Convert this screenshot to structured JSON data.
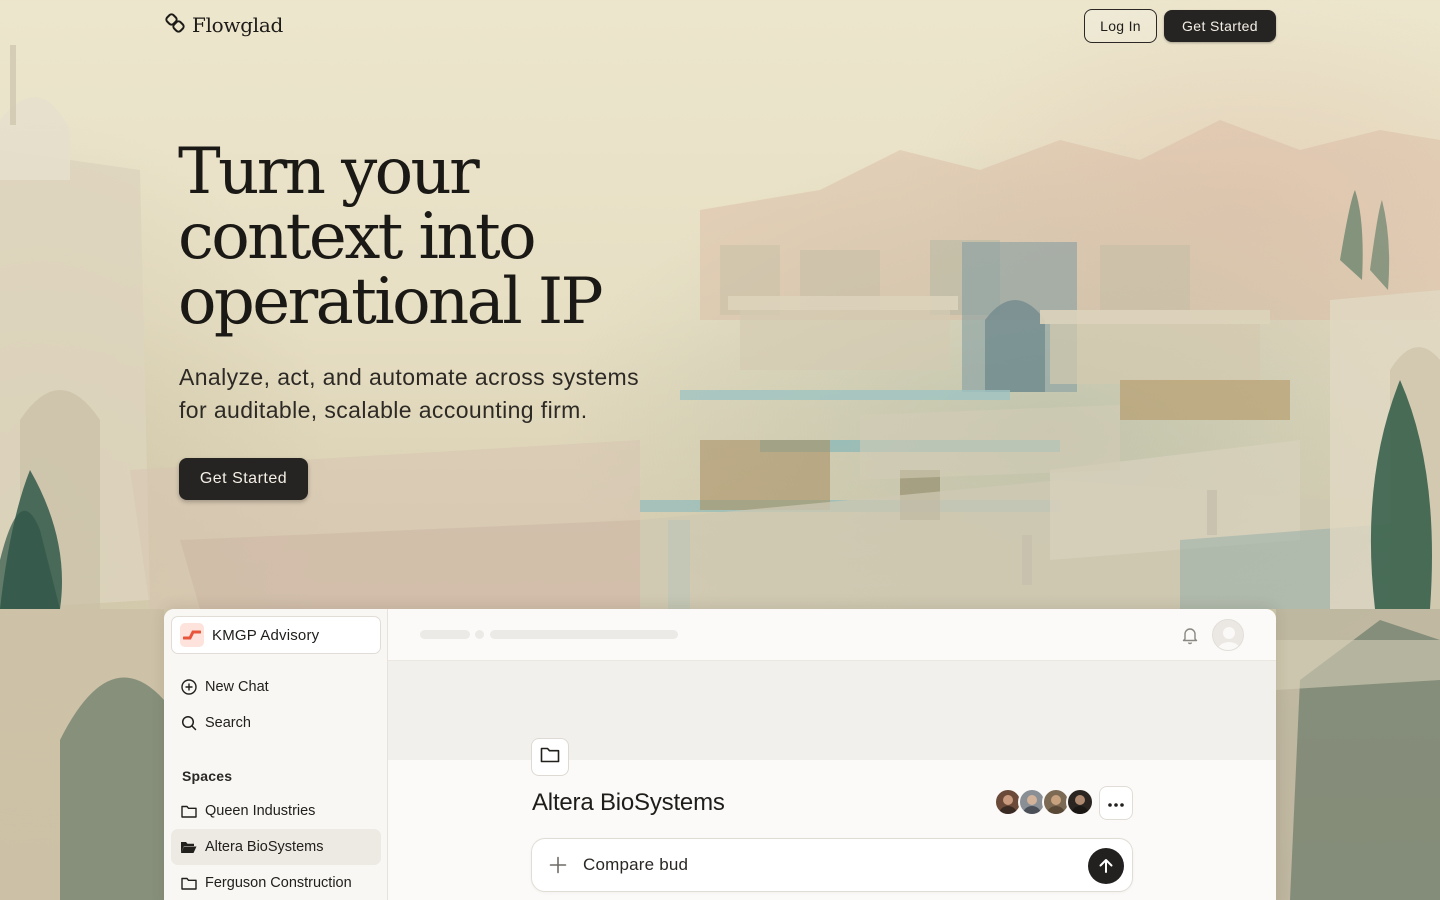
{
  "brand": {
    "name": "Flowglad"
  },
  "nav": {
    "login_label": "Log In",
    "get_started_label": "Get Started"
  },
  "hero": {
    "title_lines": [
      "Turn your",
      "context into",
      "operational IP"
    ],
    "subtitle_lines": [
      "Analyze, act, and automate across systems",
      "for auditable, scalable accounting firm."
    ],
    "cta_label": "Get Started"
  },
  "app": {
    "org": {
      "name": "KMGP Advisory"
    },
    "sidebar": {
      "actions": [
        {
          "label": "New Chat",
          "icon": "plus-circle-icon"
        },
        {
          "label": "Search",
          "icon": "search-icon"
        }
      ],
      "spaces_heading": "Spaces",
      "spaces": [
        {
          "label": "Queen Industries",
          "icon": "folder-icon",
          "active": false
        },
        {
          "label": "Altera BioSystems",
          "icon": "folder-open-icon",
          "active": true
        },
        {
          "label": "Ferguson Construction",
          "icon": "folder-icon",
          "active": false
        }
      ]
    },
    "topbar": {
      "icons": [
        "bell-icon",
        "user-avatar"
      ]
    },
    "space": {
      "title": "Altera BioSystems",
      "member_count": 4,
      "composer_text": "Compare bud"
    }
  },
  "colors": {
    "primary_button": "#262422",
    "background": "#e7dfc4",
    "panel": "#fbfaf8",
    "sidebar_active": "#edeae4",
    "org_logo": "#e8553b"
  }
}
